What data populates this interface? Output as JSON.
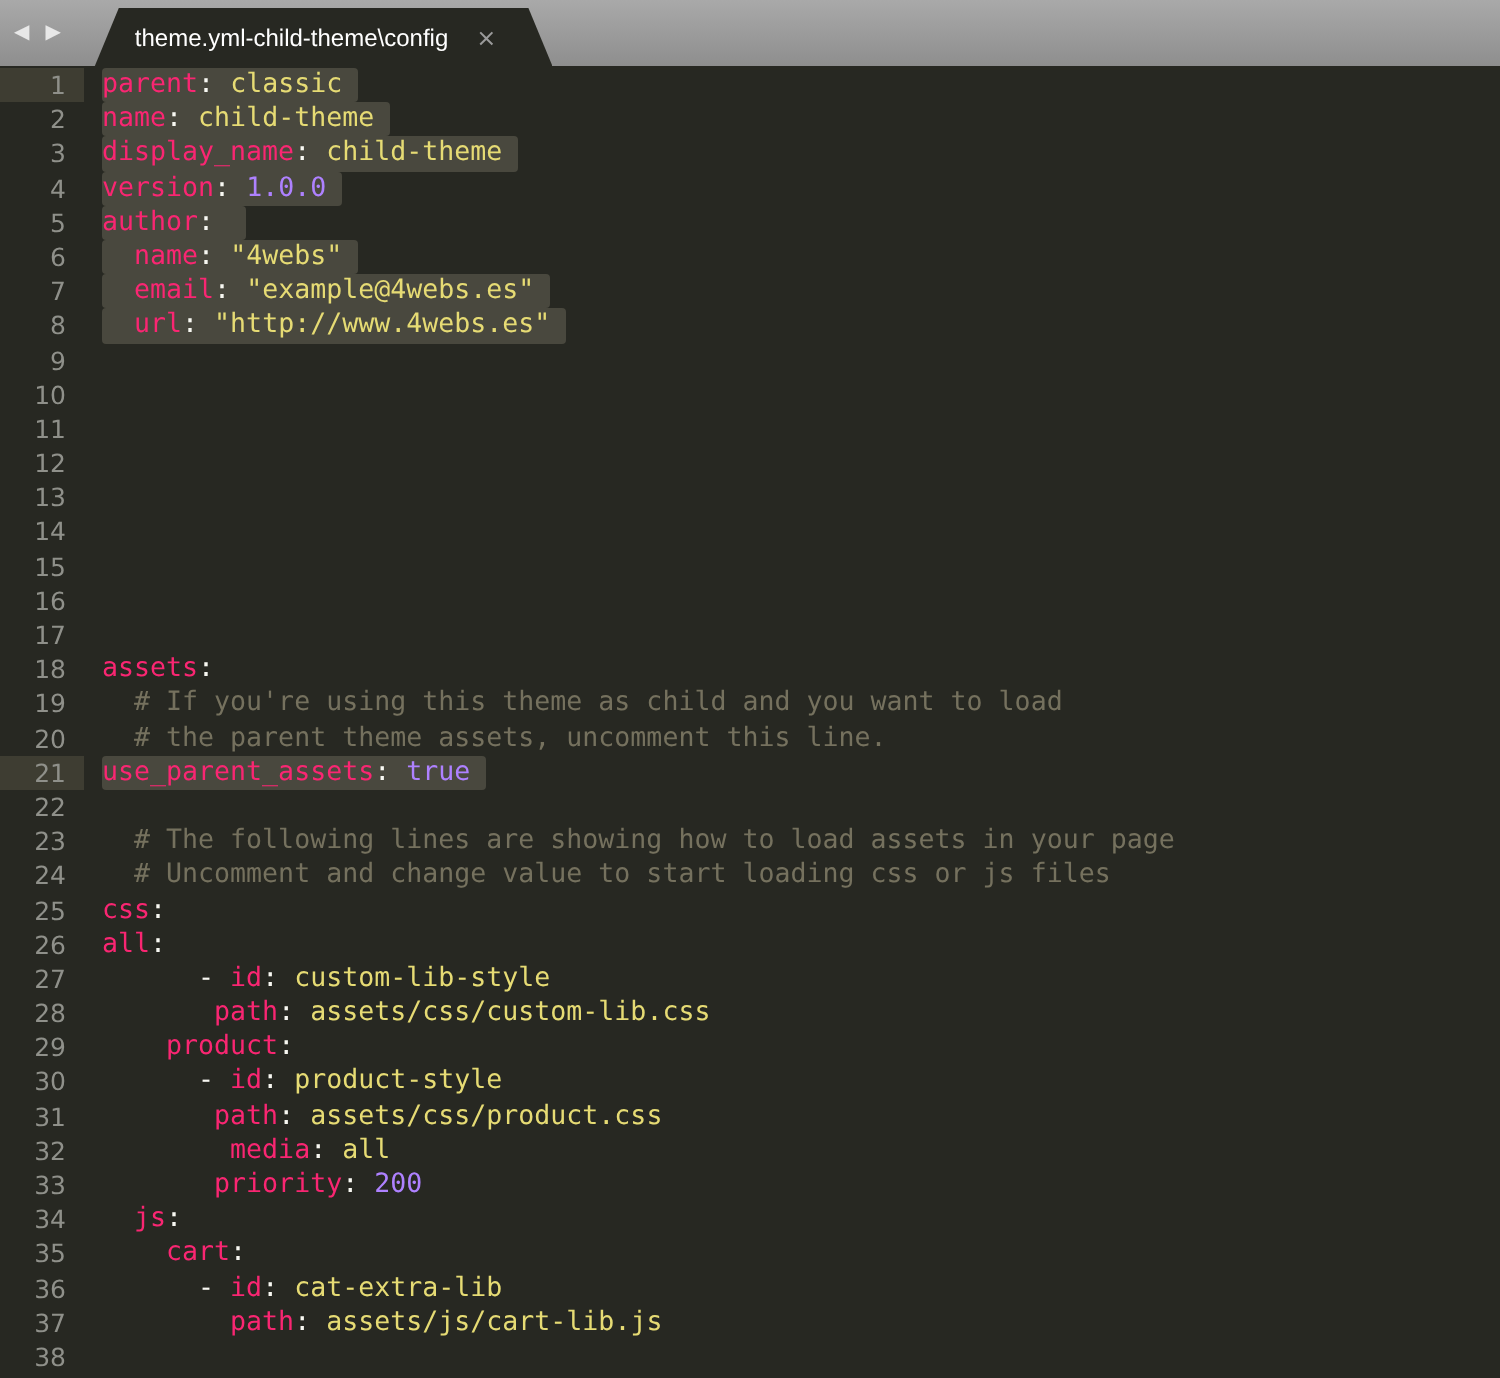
{
  "tab_bar": {
    "back": "◀",
    "forward": "▶",
    "tabs": [
      {
        "label": "theme.yml-child-theme\\config",
        "selected": true,
        "close": "×"
      }
    ]
  },
  "lines": [
    {
      "number": "1",
      "current": true,
      "selected": true,
      "tokens": [
        {
          "kind": "key",
          "text": "parent"
        },
        {
          "kind": "punct",
          "text": ": "
        },
        {
          "kind": "string",
          "text": "classic"
        }
      ]
    },
    {
      "number": "2",
      "current": false,
      "selected": true,
      "tokens": [
        {
          "kind": "key",
          "text": "name"
        },
        {
          "kind": "punct",
          "text": ": "
        },
        {
          "kind": "string",
          "text": "child-theme"
        }
      ]
    },
    {
      "number": "3",
      "current": false,
      "selected": true,
      "tokens": [
        {
          "kind": "key",
          "text": "display_name"
        },
        {
          "kind": "punct",
          "text": ": "
        },
        {
          "kind": "string",
          "text": "child-theme"
        }
      ]
    },
    {
      "number": "4",
      "current": false,
      "selected": true,
      "tokens": [
        {
          "kind": "key",
          "text": "version"
        },
        {
          "kind": "punct",
          "text": ": "
        },
        {
          "kind": "number",
          "text": "1.0.0"
        }
      ]
    },
    {
      "number": "5",
      "current": false,
      "selected": true,
      "tokens": [
        {
          "kind": "key",
          "text": "author"
        },
        {
          "kind": "punct",
          "text": ": "
        }
      ]
    },
    {
      "number": "6",
      "current": false,
      "selected": true,
      "tokens": [
        {
          "kind": "key",
          "text": "  name"
        },
        {
          "kind": "punct",
          "text": ": "
        },
        {
          "kind": "string",
          "text": "\"4webs\""
        }
      ]
    },
    {
      "number": "7",
      "current": false,
      "selected": true,
      "tokens": [
        {
          "kind": "key",
          "text": "  email"
        },
        {
          "kind": "punct",
          "text": ": "
        },
        {
          "kind": "string",
          "text": "\"example@4webs.es\""
        }
      ]
    },
    {
      "number": "8",
      "current": false,
      "selected": true,
      "tokens": [
        {
          "kind": "key",
          "text": "  url"
        },
        {
          "kind": "punct",
          "text": ": "
        },
        {
          "kind": "string",
          "text": "\"http://www.4webs.es\""
        }
      ]
    },
    {
      "number": "9",
      "current": false,
      "selected": false
    },
    {
      "number": "10",
      "current": false,
      "selected": false
    },
    {
      "number": "11",
      "current": false,
      "selected": false
    },
    {
      "number": "12",
      "current": false,
      "selected": false
    },
    {
      "number": "13",
      "current": false,
      "selected": false
    },
    {
      "number": "14",
      "current": false,
      "selected": false
    },
    {
      "number": "15",
      "current": false,
      "selected": false
    },
    {
      "number": "16",
      "current": false,
      "selected": false
    },
    {
      "number": "17",
      "current": false,
      "selected": false
    },
    {
      "number": "18",
      "current": false,
      "selected": false,
      "tokens": [
        {
          "kind": "key",
          "text": "assets"
        },
        {
          "kind": "punct",
          "text": ":"
        }
      ]
    },
    {
      "number": "19",
      "current": false,
      "selected": false,
      "tokens": [
        {
          "kind": "comment",
          "text": "  # If you're using this theme as child and you want to load"
        }
      ]
    },
    {
      "number": "20",
      "current": false,
      "selected": false,
      "tokens": [
        {
          "kind": "comment",
          "text": "  # the parent theme assets, uncomment this line."
        }
      ]
    },
    {
      "number": "21",
      "current": true,
      "selected": true,
      "tokens": [
        {
          "kind": "key",
          "text": "use_parent_assets"
        },
        {
          "kind": "punct",
          "text": ": "
        },
        {
          "kind": "number",
          "text": "true"
        }
      ]
    },
    {
      "number": "22",
      "current": false,
      "selected": false
    },
    {
      "number": "23",
      "current": false,
      "selected": false,
      "tokens": [
        {
          "kind": "comment",
          "text": "  # The following lines are showing how to load assets in your page"
        }
      ]
    },
    {
      "number": "24",
      "current": false,
      "selected": false,
      "tokens": [
        {
          "kind": "comment",
          "text": "  # Uncomment and change value to start loading css or js files"
        }
      ]
    },
    {
      "number": "25",
      "current": false,
      "selected": false,
      "tokens": [
        {
          "kind": "key",
          "text": "css"
        },
        {
          "kind": "punct",
          "text": ":"
        }
      ]
    },
    {
      "number": "26",
      "current": false,
      "selected": false,
      "tokens": [
        {
          "kind": "key",
          "text": "all"
        },
        {
          "kind": "punct",
          "text": ":"
        }
      ]
    },
    {
      "number": "27",
      "current": false,
      "selected": false,
      "tokens": [
        {
          "kind": "punct",
          "text": "      - "
        },
        {
          "kind": "key",
          "text": "id"
        },
        {
          "kind": "punct",
          "text": ": "
        },
        {
          "kind": "string",
          "text": "custom-lib-style"
        }
      ]
    },
    {
      "number": "28",
      "current": false,
      "selected": false,
      "tokens": [
        {
          "kind": "key",
          "text": "       path"
        },
        {
          "kind": "punct",
          "text": ": "
        },
        {
          "kind": "string",
          "text": "assets/css/custom-lib.css"
        }
      ]
    },
    {
      "number": "29",
      "current": false,
      "selected": false,
      "tokens": [
        {
          "kind": "key",
          "text": "    product"
        },
        {
          "kind": "punct",
          "text": ":"
        }
      ]
    },
    {
      "number": "30",
      "current": false,
      "selected": false,
      "tokens": [
        {
          "kind": "punct",
          "text": "      - "
        },
        {
          "kind": "key",
          "text": "id"
        },
        {
          "kind": "punct",
          "text": ": "
        },
        {
          "kind": "string",
          "text": "product-style"
        }
      ]
    },
    {
      "number": "31",
      "current": false,
      "selected": false,
      "tokens": [
        {
          "kind": "key",
          "text": "       path"
        },
        {
          "kind": "punct",
          "text": ": "
        },
        {
          "kind": "string",
          "text": "assets/css/product.css"
        }
      ]
    },
    {
      "number": "32",
      "current": false,
      "selected": false,
      "tokens": [
        {
          "kind": "key",
          "text": "        media"
        },
        {
          "kind": "punct",
          "text": ": "
        },
        {
          "kind": "string",
          "text": "all"
        }
      ]
    },
    {
      "number": "33",
      "current": false,
      "selected": false,
      "tokens": [
        {
          "kind": "key",
          "text": "       priority"
        },
        {
          "kind": "punct",
          "text": ": "
        },
        {
          "kind": "number",
          "text": "200"
        }
      ]
    },
    {
      "number": "34",
      "current": false,
      "selected": false,
      "tokens": [
        {
          "kind": "key",
          "text": "  js"
        },
        {
          "kind": "punct",
          "text": ":"
        }
      ]
    },
    {
      "number": "35",
      "current": false,
      "selected": false,
      "tokens": [
        {
          "kind": "key",
          "text": "    cart"
        },
        {
          "kind": "punct",
          "text": ":"
        }
      ]
    },
    {
      "number": "36",
      "current": false,
      "selected": false,
      "tokens": [
        {
          "kind": "punct",
          "text": "      - "
        },
        {
          "kind": "key",
          "text": "id"
        },
        {
          "kind": "punct",
          "text": ": "
        },
        {
          "kind": "string",
          "text": "cat-extra-lib"
        }
      ]
    },
    {
      "number": "37",
      "current": false,
      "selected": false,
      "tokens": [
        {
          "kind": "key",
          "text": "        path"
        },
        {
          "kind": "punct",
          "text": ": "
        },
        {
          "kind": "string",
          "text": "assets/js/cart-lib.js"
        }
      ]
    },
    {
      "number": "38",
      "current": false,
      "selected": false
    }
  ]
}
